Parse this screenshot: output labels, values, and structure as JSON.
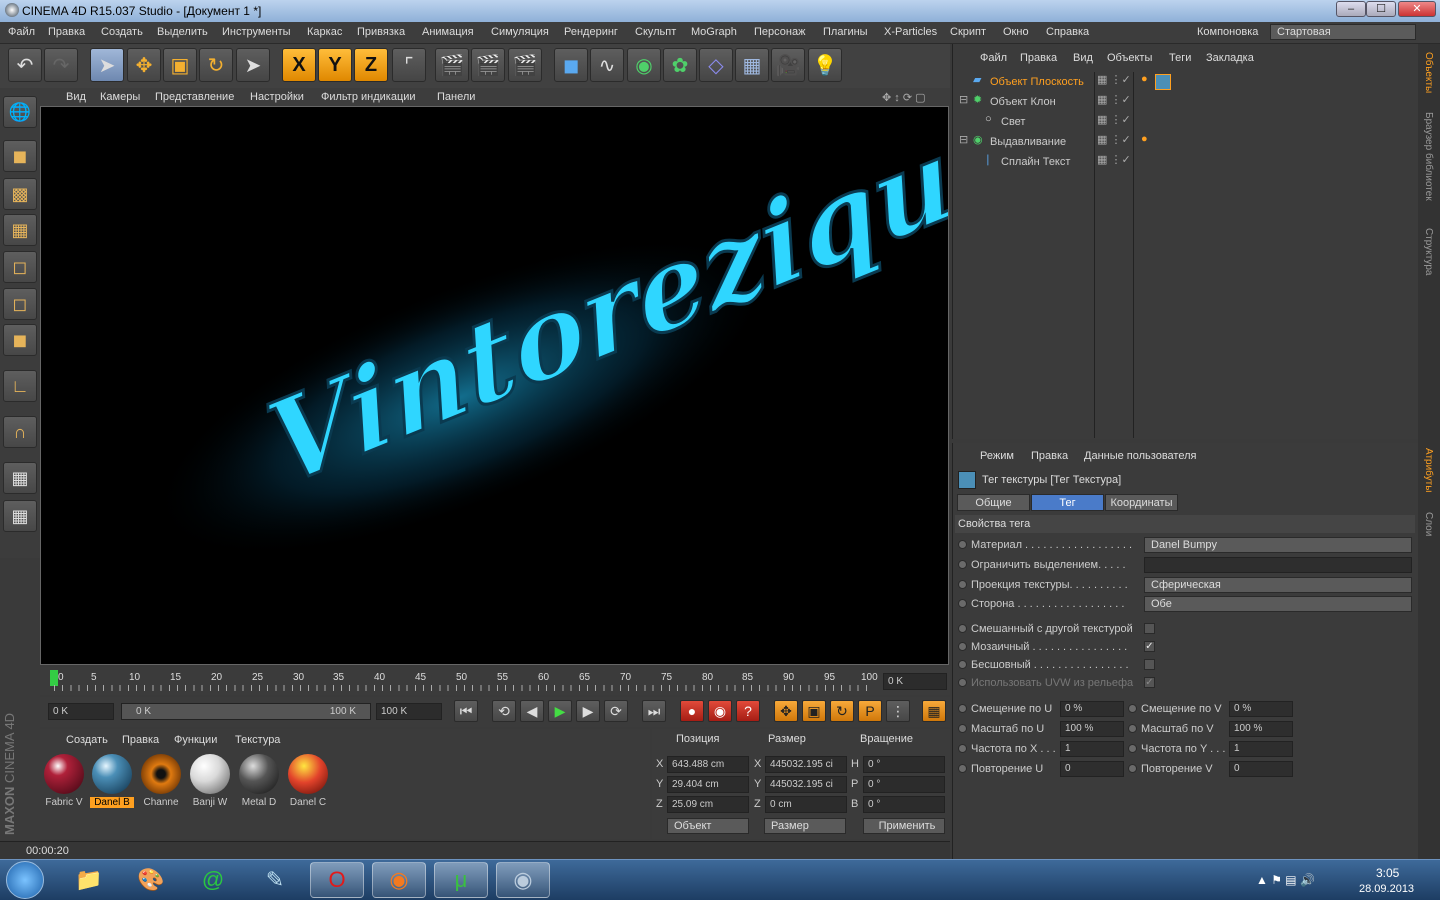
{
  "window": {
    "title": "CINEMA 4D R15.037 Studio - [Документ 1 *]",
    "min": "‒",
    "max": "☐",
    "close": "✕"
  },
  "menu": [
    "Файл",
    "Правка",
    "Создать",
    "Выделить",
    "Инструменты",
    "Каркас",
    "Привязка",
    "Анимация",
    "Симуляция",
    "Рендеринг",
    "Скульпт",
    "MoGraph",
    "Персонаж",
    "Плагины",
    "X-Particles",
    "Скрипт",
    "Окно",
    "Справка"
  ],
  "layout": {
    "label": "Компоновка",
    "value": "Стартовая"
  },
  "viewport_menu": [
    "Вид",
    "Камеры",
    "Представление",
    "Настройки",
    "Фильтр индикации",
    "Панели"
  ],
  "scene": {
    "text": "Vintoreziqus"
  },
  "timeline": {
    "ticks": [
      "0",
      "5",
      "10",
      "15",
      "20",
      "25",
      "30",
      "35",
      "40",
      "45",
      "50",
      "55",
      "60",
      "65",
      "70",
      "75",
      "80",
      "85",
      "90",
      "95",
      "100"
    ],
    "current": "0 K",
    "playhead": 0
  },
  "transport": {
    "start": "0 K",
    "range_start": "0 K",
    "range_end": "100 K",
    "end": "100 K"
  },
  "materials": {
    "menu": [
      "Создать",
      "Правка",
      "Функции",
      "Текстура"
    ],
    "items": [
      {
        "label": "Fabric V",
        "color": "#b0213a"
      },
      {
        "label": "Danel B",
        "color": "#4b8fb7",
        "selected": true
      },
      {
        "label": "Channe",
        "color": "#e07a10"
      },
      {
        "label": "Banji W",
        "color": "#d9d9d9"
      },
      {
        "label": "Metal D",
        "color": "#555555"
      },
      {
        "label": "Danel C",
        "color": "#e2432b"
      }
    ]
  },
  "coords": {
    "headers": [
      "Позиция",
      "Размер",
      "Вращение"
    ],
    "rows": [
      {
        "axis": "X",
        "pos": "643.488 cm",
        "saxis": "X",
        "size": "445032.195 ci",
        "raxis": "H",
        "rot": "0 °"
      },
      {
        "axis": "Y",
        "pos": "29.404 cm",
        "saxis": "Y",
        "size": "445032.195 ci",
        "raxis": "P",
        "rot": "0 °"
      },
      {
        "axis": "Z",
        "pos": "25.09 cm",
        "saxis": "Z",
        "size": "0 cm",
        "raxis": "B",
        "rot": "0 °"
      }
    ],
    "mode1": "Объект",
    "mode2": "Размер",
    "apply": "Применить"
  },
  "status": {
    "time": "00:00:20"
  },
  "objects": {
    "menu": [
      "Файл",
      "Правка",
      "Вид",
      "Объекты",
      "Теги",
      "Закладка"
    ],
    "items": [
      {
        "name": "Объект Плоскость",
        "active": true,
        "depth": 0
      },
      {
        "name": "Объект Клон",
        "active": false,
        "depth": 0
      },
      {
        "name": "Свет",
        "active": false,
        "depth": 1
      },
      {
        "name": "Выдавливание",
        "active": false,
        "depth": 0
      },
      {
        "name": "Сплайн Текст",
        "active": false,
        "depth": 1
      }
    ]
  },
  "attributes": {
    "menu": [
      "Режим",
      "Правка",
      "Данные пользователя"
    ],
    "title": "Тег текстуры [Тег Текстура]",
    "tabs": [
      "Общие",
      "Тег",
      "Координаты"
    ],
    "section": "Свойства тега",
    "material_label": "Материал . . . . . . . . . . . . . . . . . .",
    "material_value": "Danel Bumpy",
    "restrict_label": "Ограничить выделением. . . . .",
    "projection_label": "Проекция текстуры. . . . . . . . . .",
    "projection_value": "Сферическая",
    "side_label": "Сторона . . . . . . . . . . . . . . . . . .",
    "side_value": "Обе",
    "mix_label": "Смешанный с другой текстурой",
    "tile_label": "Мозаичный . . . . . . . . . . . . . . . .",
    "seamless_label": "Бесшовный . . . . . . . . . . . . . . . .",
    "uvw_label": "Использовать UVW из рельефа",
    "offu_label": "Смещение по U",
    "offu": "0 %",
    "offv_label": "Смещение по V",
    "offv": "0 %",
    "scu_label": "Масштаб по U",
    "scu": "100 %",
    "scv_label": "Масштаб по V",
    "scv": "100 %",
    "frx_label": "Частота по X . . .",
    "frx": "1",
    "fry_label": "Частота по Y . . .",
    "fry": "1",
    "repu_label": "Повторение U",
    "repu": "0",
    "repv_label": "Повторение V",
    "repv": "0"
  },
  "right_tabs": [
    "Объекты",
    "Браузер библиотек",
    "Структура",
    "Атрибуты",
    "Слои"
  ],
  "taskbar": {
    "time": "3:05",
    "date": "28.09.2013"
  },
  "colors": {
    "accent": "#ffa020",
    "selection": "#4a7bc9",
    "glow": "#21c6ff"
  }
}
